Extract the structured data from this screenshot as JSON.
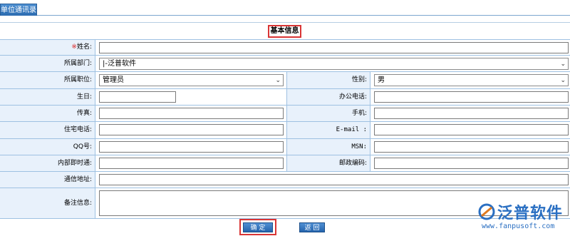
{
  "header": {
    "tab_label": "单位通讯录"
  },
  "section": {
    "title": "基本信息"
  },
  "fields": {
    "name": {
      "required_mark": "※",
      "label": "姓名:"
    },
    "department": {
      "label": "所属部门:",
      "value": "|-泛普软件"
    },
    "position": {
      "label": "所属职位:",
      "value": "管理员"
    },
    "gender": {
      "label": "性别:",
      "value": "男"
    },
    "birthday": {
      "label": "生日:"
    },
    "office_phone": {
      "label": "办公电话:"
    },
    "fax": {
      "label": "传真:"
    },
    "mobile": {
      "label": "手机:"
    },
    "home_phone": {
      "label": "住宅电话:"
    },
    "email": {
      "label": "E-mail :"
    },
    "qq": {
      "label": "QQ号:"
    },
    "msn": {
      "label": "MSN:"
    },
    "internal_im": {
      "label": "内部即时通:"
    },
    "postcode": {
      "label": "邮政编码:"
    },
    "address": {
      "label": "通信地址:"
    },
    "notes": {
      "label": "备注信息:"
    }
  },
  "buttons": {
    "confirm": "确 定",
    "back": "返 回"
  },
  "watermark": {
    "brand": "泛普软件",
    "url": "www.fanpusoft.com"
  },
  "colors": {
    "label_bg": "#e8f1fb",
    "border": "#9ec1e2",
    "highlight": "#d93535",
    "button": "#2f74bf"
  }
}
